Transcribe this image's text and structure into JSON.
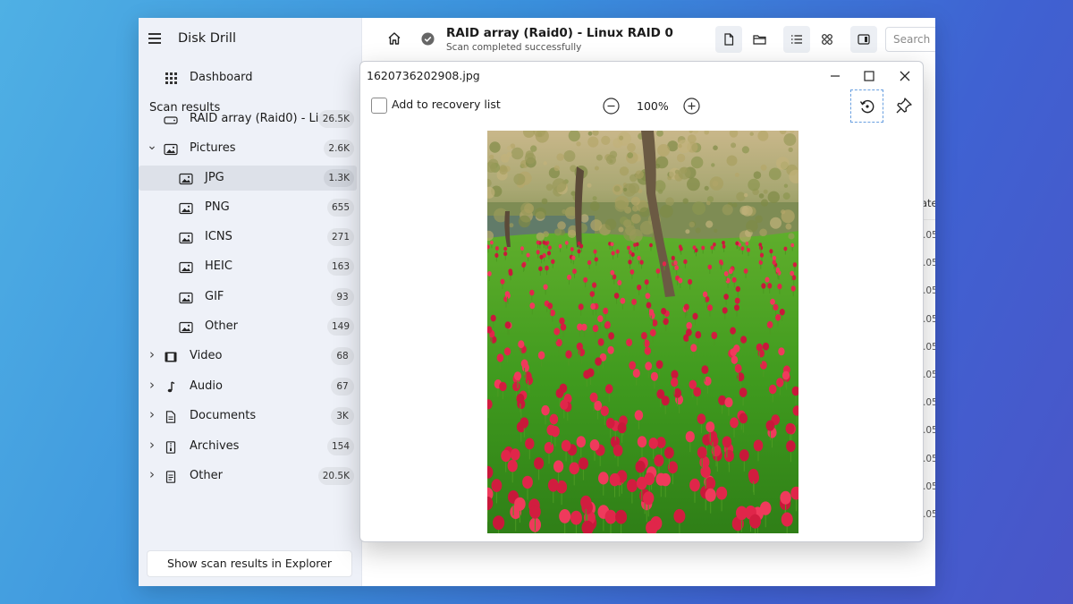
{
  "app": {
    "title": "Disk Drill"
  },
  "sidebar": {
    "dashboard_label": "Dashboard",
    "section_title": "Scan results",
    "items": [
      {
        "label": "RAID array (Raid0) - Li...",
        "count": "26.5K",
        "icon": "drive-icon",
        "level": 0,
        "chevron": ""
      },
      {
        "label": "Pictures",
        "count": "2.6K",
        "icon": "image-icon",
        "level": 0,
        "chevron": "expanded"
      },
      {
        "label": "JPG",
        "count": "1.3K",
        "icon": "image-icon",
        "level": 1,
        "chevron": "",
        "selected": true
      },
      {
        "label": "PNG",
        "count": "655",
        "icon": "image-icon",
        "level": 1,
        "chevron": ""
      },
      {
        "label": "ICNS",
        "count": "271",
        "icon": "image-icon",
        "level": 1,
        "chevron": ""
      },
      {
        "label": "HEIC",
        "count": "163",
        "icon": "image-icon",
        "level": 1,
        "chevron": ""
      },
      {
        "label": "GIF",
        "count": "93",
        "icon": "image-icon",
        "level": 1,
        "chevron": ""
      },
      {
        "label": "Other",
        "count": "149",
        "icon": "image-icon",
        "level": 1,
        "chevron": ""
      },
      {
        "label": "Video",
        "count": "68",
        "icon": "film-icon",
        "level": 0,
        "chevron": "collapsed"
      },
      {
        "label": "Audio",
        "count": "67",
        "icon": "music-note-icon",
        "level": 0,
        "chevron": "collapsed"
      },
      {
        "label": "Documents",
        "count": "3K",
        "icon": "document-icon",
        "level": 0,
        "chevron": "collapsed"
      },
      {
        "label": "Archives",
        "count": "154",
        "icon": "archive-icon",
        "level": 0,
        "chevron": "collapsed"
      },
      {
        "label": "Other",
        "count": "20.5K",
        "icon": "file-icon",
        "level": 0,
        "chevron": "collapsed"
      }
    ],
    "explorer_button": "Show scan results in Explorer"
  },
  "header": {
    "drive_title": "RAID array (Raid0) - Linux RAID 0",
    "drive_status": "Scan completed successfully",
    "search_placeholder": "Search"
  },
  "results_fragment": {
    "column_header": "ate",
    "cells": [
      ".05",
      ".05",
      ".05",
      ".05",
      ".05",
      ".05",
      ".05",
      ".05",
      ".05",
      ".05",
      ".05"
    ]
  },
  "preview": {
    "filename": "1620736202908.jpg",
    "add_to_recovery_label": "Add to recovery list",
    "zoom_level": "100%"
  },
  "colors": {
    "accent_focus": "#6aa0e0",
    "tulip_red": "#e0264a",
    "grass_green": "#3f9a1e"
  }
}
